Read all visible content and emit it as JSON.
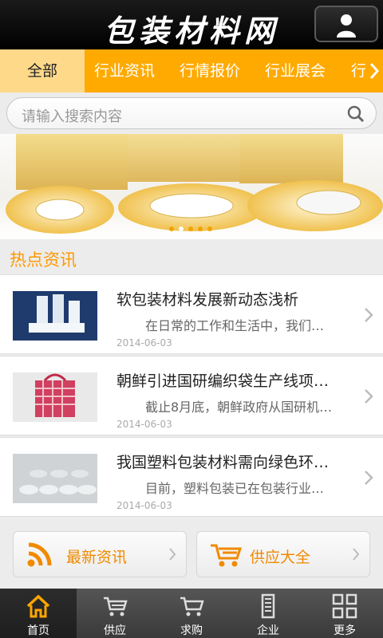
{
  "header": {
    "title": "包装材料网"
  },
  "tabs": [
    "全部",
    "行业资讯",
    "行情报价",
    "行业展会",
    "行"
  ],
  "search": {
    "placeholder": "请输入搜索内容"
  },
  "section": {
    "hot_news": "热点资讯"
  },
  "news": [
    {
      "title": "软包装材料发展新动态浅析",
      "desc": "在日常的工作和生活中，我们…",
      "date": "2014-06-03"
    },
    {
      "title": "朝鲜引进国研编织袋生产线项…",
      "desc": "截止8月底，朝鲜政府从国研机…",
      "date": "2014-06-03"
    },
    {
      "title": "我国塑料包装材料需向绿色环…",
      "desc": "目前，塑料包装已在包装行业…",
      "date": "2014-06-03"
    }
  ],
  "quick": {
    "latest_news": "最新资讯",
    "supply": "供应大全"
  },
  "nav": [
    "首页",
    "供应",
    "求购",
    "企业",
    "更多"
  ],
  "colors": {
    "accent": "#ffaa00",
    "accent_text": "#f08a00",
    "header": "#000000"
  }
}
